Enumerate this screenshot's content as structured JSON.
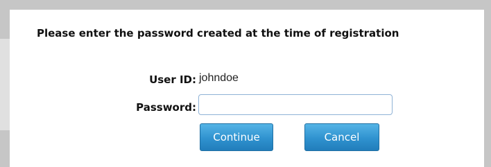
{
  "dialog": {
    "heading": "Please enter the password created at the time of registration",
    "user_id_label": "User ID:",
    "user_id_value": "johndoe",
    "password_label": "Password:",
    "password_value": "",
    "continue_label": "Continue",
    "cancel_label": "Cancel"
  },
  "colors": {
    "button_top": "#55b4e6",
    "button_bottom": "#217dbb",
    "input_border": "#8fb2d6",
    "background": "#c6c6c6"
  }
}
